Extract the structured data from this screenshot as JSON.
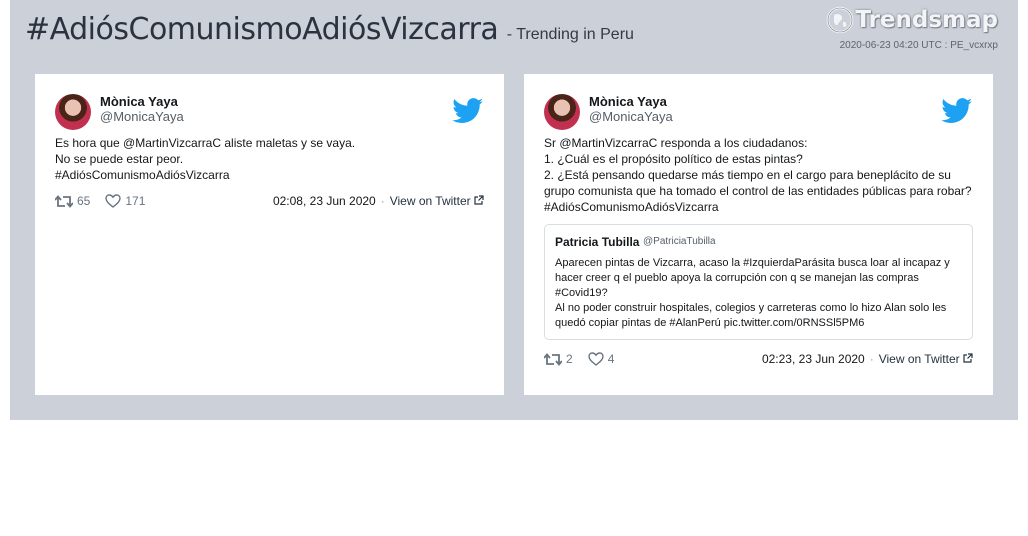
{
  "header": {
    "hashtag": "#AdiósComunismoAdiósVizcarra",
    "subtitle": "- Trending in Peru",
    "logo_text": "Trendsmap",
    "timestamp": "2020-06-23 04:20 UTC : PE_vcxrxp"
  },
  "tweets": [
    {
      "name": "Mònica Yaya",
      "handle": "@MonicaYaya",
      "text": "Es hora que @MartinVizcarraC aliste maletas y se vaya.\nNo se puede estar peor.\n#AdiósComunismoAdiósVizcarra",
      "retweets": "65",
      "likes": "171",
      "time": "02:08, 23 Jun 2020",
      "view_link": "View on Twitter"
    },
    {
      "name": "Mònica Yaya",
      "handle": "@MonicaYaya",
      "text": "Sr @MartinVizcarraC responda a los ciudadanos:\n1. ¿Cuál es el propósito político de estas pintas?\n2. ¿Está pensando quedarse más tiempo en el cargo para beneplácito de su grupo comunista que ha tomado el control de las entidades públicas para robar?\n#AdiósComunismoAdiósVizcarra",
      "quote": {
        "name": "Patricia Tubilla",
        "handle": "@PatriciaTubilla",
        "text": "Aparecen pintas de Vizcarra, acaso la #IzquierdaParásita busca loar al incapaz y hacer creer q el pueblo apoya la corrupción con q se manejan las compras #Covid19?\nAl no poder construir hospitales, colegios y carreteras como lo hizo Alan solo les quedó copiar pintas de #AlanPerú pic.twitter.com/0RNSSl5PM6"
      },
      "retweets": "2",
      "likes": "4",
      "time": "02:23, 23 Jun 2020",
      "view_link": "View on Twitter"
    }
  ],
  "colors": {
    "panel_bg": "#ccd0d8",
    "twitter_blue": "#1da1f2"
  },
  "icons": [
    "twitter-bird-icon",
    "retweet-icon",
    "heart-icon",
    "external-link-icon",
    "trendsmap-logo-icon"
  ]
}
